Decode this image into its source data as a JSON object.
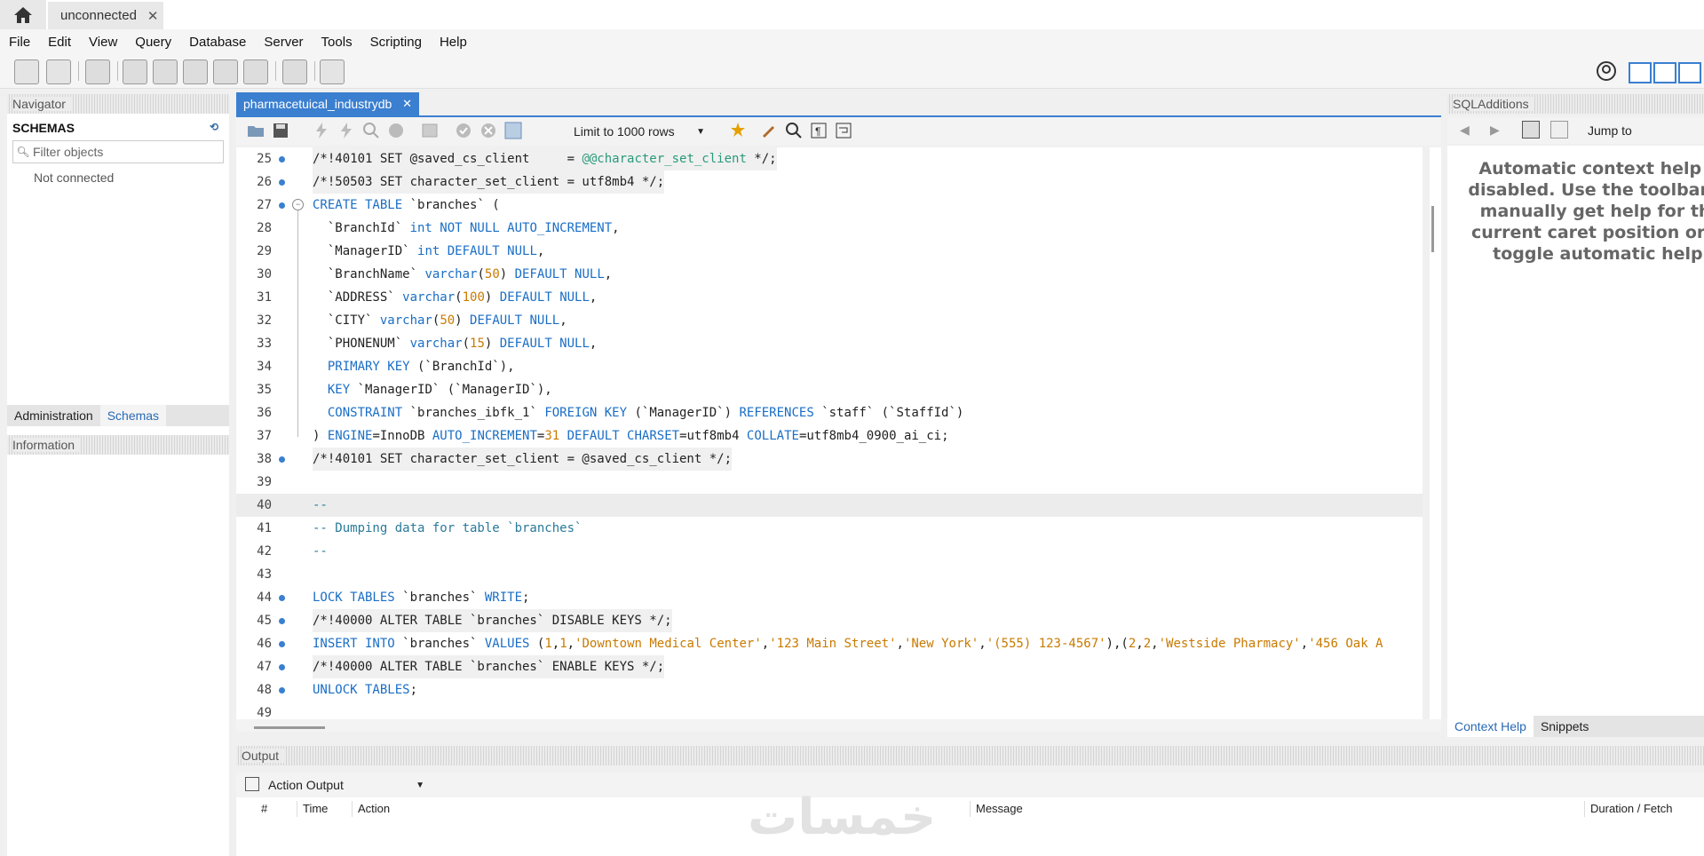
{
  "window": {
    "connection_tab": "unconnected",
    "close_symbol": "✕"
  },
  "menu": [
    "File",
    "Edit",
    "View",
    "Query",
    "Database",
    "Server",
    "Tools",
    "Scripting",
    "Help"
  ],
  "navigator": {
    "header": "Navigator",
    "schemas_title": "SCHEMAS",
    "filter_placeholder": "Filter objects",
    "status": "Not connected",
    "tabs": [
      "Administration",
      "Schemas"
    ],
    "info_header": "Information"
  },
  "editor": {
    "tab_label": "pharmacetuical_industrydb",
    "limit_label": "Limit to 1000 rows",
    "lines": [
      {
        "n": "25",
        "dot": true
      },
      {
        "n": "26",
        "dot": true
      },
      {
        "n": "27",
        "dot": true
      },
      {
        "n": "28",
        "dot": false
      },
      {
        "n": "29",
        "dot": false
      },
      {
        "n": "30",
        "dot": false
      },
      {
        "n": "31",
        "dot": false
      },
      {
        "n": "32",
        "dot": false
      },
      {
        "n": "33",
        "dot": false
      },
      {
        "n": "34",
        "dot": false
      },
      {
        "n": "35",
        "dot": false
      },
      {
        "n": "36",
        "dot": false
      },
      {
        "n": "37",
        "dot": false
      },
      {
        "n": "38",
        "dot": true
      },
      {
        "n": "39",
        "dot": false
      },
      {
        "n": "40",
        "dot": false
      },
      {
        "n": "41",
        "dot": false
      },
      {
        "n": "42",
        "dot": false
      },
      {
        "n": "43",
        "dot": false
      },
      {
        "n": "44",
        "dot": true
      },
      {
        "n": "45",
        "dot": true
      },
      {
        "n": "46",
        "dot": true
      },
      {
        "n": "47",
        "dot": true
      },
      {
        "n": "48",
        "dot": true
      },
      {
        "n": "49",
        "dot": false
      }
    ]
  },
  "sql_additions": {
    "header": "SQLAdditions",
    "jump_to": "Jump to",
    "help_text": "Automatic context help is disabled. Use the toolbar to manually get help for the current caret position or to toggle automatic help.",
    "tabs": [
      "Context Help",
      "Snippets"
    ]
  },
  "output": {
    "header": "Output",
    "selector": "Action Output",
    "columns": [
      "#",
      "Time",
      "Action",
      "Message",
      "Duration / Fetch"
    ]
  },
  "colors": {
    "accent": "#3a7fd0",
    "keyword": "#1a6ec6",
    "string": "#c97a00"
  }
}
